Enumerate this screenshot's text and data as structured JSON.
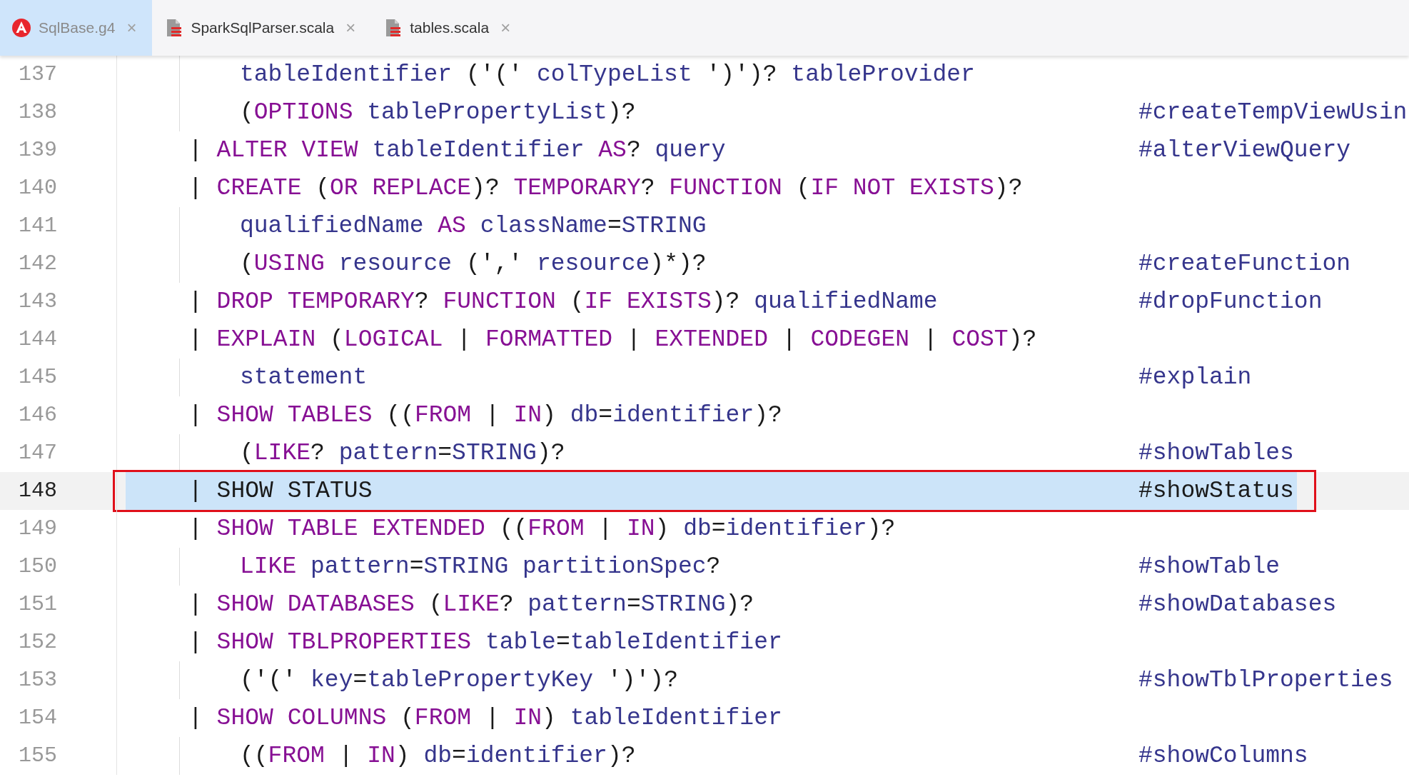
{
  "tabs": [
    {
      "label": "SqlBase.g4",
      "kind": "antlr",
      "close": "×",
      "selected": true
    },
    {
      "label": "SparkSqlParser.scala",
      "kind": "scala",
      "close": "×",
      "selected": false
    },
    {
      "label": "tables.scala",
      "kind": "scala",
      "close": "×",
      "selected": false
    }
  ],
  "lines": [
    {
      "number": "137",
      "kind": "cont",
      "selected": false,
      "tokens": [
        {
          "kind": "id",
          "text": "tableIdentifier"
        },
        {
          "kind": "p",
          "text": " ('(' "
        },
        {
          "kind": "id",
          "text": "colTypeList"
        },
        {
          "kind": "p",
          "text": " ')')? "
        },
        {
          "kind": "id",
          "text": "tableProvider"
        }
      ]
    },
    {
      "number": "138",
      "kind": "cont",
      "selected": false,
      "tokens": [
        {
          "kind": "p",
          "text": "("
        },
        {
          "kind": "kw",
          "text": "OPTIONS"
        },
        {
          "kind": "id",
          "text": " tablePropertyList"
        },
        {
          "kind": "p",
          "text": ")?"
        }
      ],
      "label": "#createTempViewUsin"
    },
    {
      "number": "139",
      "kind": "alt",
      "selected": false,
      "tokens": [
        {
          "kind": "p",
          "text": "| "
        },
        {
          "kind": "kw",
          "text": "ALTER VIEW"
        },
        {
          "kind": "id",
          "text": " tableIdentifier "
        },
        {
          "kind": "kw",
          "text": "AS"
        },
        {
          "kind": "p",
          "text": "? "
        },
        {
          "kind": "id",
          "text": "query"
        }
      ],
      "label": "#alterViewQuery"
    },
    {
      "number": "140",
      "kind": "alt",
      "selected": false,
      "tokens": [
        {
          "kind": "p",
          "text": "| "
        },
        {
          "kind": "kw",
          "text": "CREATE"
        },
        {
          "kind": "p",
          "text": " ("
        },
        {
          "kind": "kw",
          "text": "OR REPLACE"
        },
        {
          "kind": "p",
          "text": ")? "
        },
        {
          "kind": "kw",
          "text": "TEMPORARY"
        },
        {
          "kind": "p",
          "text": "? "
        },
        {
          "kind": "kw",
          "text": "FUNCTION"
        },
        {
          "kind": "p",
          "text": " ("
        },
        {
          "kind": "kw",
          "text": "IF NOT EXISTS"
        },
        {
          "kind": "p",
          "text": ")?"
        }
      ]
    },
    {
      "number": "141",
      "kind": "cont",
      "selected": false,
      "tokens": [
        {
          "kind": "id",
          "text": "qualifiedName "
        },
        {
          "kind": "kw",
          "text": "AS"
        },
        {
          "kind": "id",
          "text": " className"
        },
        {
          "kind": "p",
          "text": "="
        },
        {
          "kind": "id",
          "text": "STRING"
        }
      ]
    },
    {
      "number": "142",
      "kind": "cont",
      "selected": false,
      "tokens": [
        {
          "kind": "p",
          "text": "("
        },
        {
          "kind": "kw",
          "text": "USING"
        },
        {
          "kind": "id",
          "text": " resource"
        },
        {
          "kind": "p",
          "text": " (',' "
        },
        {
          "kind": "id",
          "text": "resource"
        },
        {
          "kind": "p",
          "text": ")*)?"
        }
      ],
      "label": "#createFunction"
    },
    {
      "number": "143",
      "kind": "alt",
      "selected": false,
      "tokens": [
        {
          "kind": "p",
          "text": "| "
        },
        {
          "kind": "kw",
          "text": "DROP TEMPORARY"
        },
        {
          "kind": "p",
          "text": "? "
        },
        {
          "kind": "kw",
          "text": "FUNCTION"
        },
        {
          "kind": "p",
          "text": " ("
        },
        {
          "kind": "kw",
          "text": "IF EXISTS"
        },
        {
          "kind": "p",
          "text": ")? "
        },
        {
          "kind": "id",
          "text": "qualifiedName"
        }
      ],
      "label": "#dropFunction"
    },
    {
      "number": "144",
      "kind": "alt",
      "selected": false,
      "tokens": [
        {
          "kind": "p",
          "text": "| "
        },
        {
          "kind": "kw",
          "text": "EXPLAIN"
        },
        {
          "kind": "p",
          "text": " ("
        },
        {
          "kind": "kw",
          "text": "LOGICAL"
        },
        {
          "kind": "p",
          "text": " | "
        },
        {
          "kind": "kw",
          "text": "FORMATTED"
        },
        {
          "kind": "p",
          "text": " | "
        },
        {
          "kind": "kw",
          "text": "EXTENDED"
        },
        {
          "kind": "p",
          "text": " | "
        },
        {
          "kind": "kw",
          "text": "CODEGEN"
        },
        {
          "kind": "p",
          "text": " | "
        },
        {
          "kind": "kw",
          "text": "COST"
        },
        {
          "kind": "p",
          "text": ")?"
        }
      ]
    },
    {
      "number": "145",
      "kind": "cont",
      "selected": false,
      "tokens": [
        {
          "kind": "id",
          "text": "statement"
        }
      ],
      "label": "#explain"
    },
    {
      "number": "146",
      "kind": "alt",
      "selected": false,
      "tokens": [
        {
          "kind": "p",
          "text": "| "
        },
        {
          "kind": "kw",
          "text": "SHOW TABLES"
        },
        {
          "kind": "p",
          "text": " (("
        },
        {
          "kind": "kw",
          "text": "FROM"
        },
        {
          "kind": "p",
          "text": " | "
        },
        {
          "kind": "kw",
          "text": "IN"
        },
        {
          "kind": "p",
          "text": ") "
        },
        {
          "kind": "id",
          "text": "db"
        },
        {
          "kind": "p",
          "text": "="
        },
        {
          "kind": "id",
          "text": "identifier"
        },
        {
          "kind": "p",
          "text": ")?"
        }
      ]
    },
    {
      "number": "147",
      "kind": "cont",
      "selected": false,
      "tokens": [
        {
          "kind": "p",
          "text": "("
        },
        {
          "kind": "kw",
          "text": "LIKE"
        },
        {
          "kind": "p",
          "text": "? "
        },
        {
          "kind": "id",
          "text": "pattern"
        },
        {
          "kind": "p",
          "text": "="
        },
        {
          "kind": "id",
          "text": "STRING"
        },
        {
          "kind": "p",
          "text": ")?"
        }
      ],
      "label": "#showTables"
    },
    {
      "number": "148",
      "kind": "alt",
      "selected": true,
      "tokens": [
        {
          "kind": "p",
          "text": "| "
        },
        {
          "kind": "kw",
          "text": "SHOW STATUS"
        }
      ],
      "label": "#showStatus"
    },
    {
      "number": "149",
      "kind": "alt",
      "selected": false,
      "tokens": [
        {
          "kind": "p",
          "text": "| "
        },
        {
          "kind": "kw",
          "text": "SHOW TABLE EXTENDED"
        },
        {
          "kind": "p",
          "text": " (("
        },
        {
          "kind": "kw",
          "text": "FROM"
        },
        {
          "kind": "p",
          "text": " | "
        },
        {
          "kind": "kw",
          "text": "IN"
        },
        {
          "kind": "p",
          "text": ") "
        },
        {
          "kind": "id",
          "text": "db"
        },
        {
          "kind": "p",
          "text": "="
        },
        {
          "kind": "id",
          "text": "identifier"
        },
        {
          "kind": "p",
          "text": ")?"
        }
      ]
    },
    {
      "number": "150",
      "kind": "cont",
      "selected": false,
      "tokens": [
        {
          "kind": "kw",
          "text": "LIKE"
        },
        {
          "kind": "id",
          "text": " pattern"
        },
        {
          "kind": "p",
          "text": "="
        },
        {
          "kind": "id",
          "text": "STRING partitionSpec"
        },
        {
          "kind": "p",
          "text": "?"
        }
      ],
      "label": "#showTable"
    },
    {
      "number": "151",
      "kind": "alt",
      "selected": false,
      "tokens": [
        {
          "kind": "p",
          "text": "| "
        },
        {
          "kind": "kw",
          "text": "SHOW DATABASES"
        },
        {
          "kind": "p",
          "text": " ("
        },
        {
          "kind": "kw",
          "text": "LIKE"
        },
        {
          "kind": "p",
          "text": "? "
        },
        {
          "kind": "id",
          "text": "pattern"
        },
        {
          "kind": "p",
          "text": "="
        },
        {
          "kind": "id",
          "text": "STRING"
        },
        {
          "kind": "p",
          "text": ")?"
        }
      ],
      "label": "#showDatabases"
    },
    {
      "number": "152",
      "kind": "alt",
      "selected": false,
      "tokens": [
        {
          "kind": "p",
          "text": "| "
        },
        {
          "kind": "kw",
          "text": "SHOW TBLPROPERTIES"
        },
        {
          "kind": "id",
          "text": " table"
        },
        {
          "kind": "p",
          "text": "="
        },
        {
          "kind": "id",
          "text": "tableIdentifier"
        }
      ]
    },
    {
      "number": "153",
      "kind": "cont",
      "selected": false,
      "tokens": [
        {
          "kind": "p",
          "text": "('(' "
        },
        {
          "kind": "id",
          "text": "key"
        },
        {
          "kind": "p",
          "text": "="
        },
        {
          "kind": "id",
          "text": "tablePropertyKey"
        },
        {
          "kind": "p",
          "text": " ')')?"
        }
      ],
      "label": "#showTblProperties"
    },
    {
      "number": "154",
      "kind": "alt",
      "selected": false,
      "tokens": [
        {
          "kind": "p",
          "text": "| "
        },
        {
          "kind": "kw",
          "text": "SHOW COLUMNS"
        },
        {
          "kind": "p",
          "text": " ("
        },
        {
          "kind": "kw",
          "text": "FROM"
        },
        {
          "kind": "p",
          "text": " | "
        },
        {
          "kind": "kw",
          "text": "IN"
        },
        {
          "kind": "p",
          "text": ") "
        },
        {
          "kind": "id",
          "text": "tableIdentifier"
        }
      ]
    },
    {
      "number": "155",
      "kind": "cont",
      "selected": false,
      "tokens": [
        {
          "kind": "p",
          "text": "(("
        },
        {
          "kind": "kw",
          "text": "FROM"
        },
        {
          "kind": "p",
          "text": " | "
        },
        {
          "kind": "kw",
          "text": "IN"
        },
        {
          "kind": "p",
          "text": ") "
        },
        {
          "kind": "id",
          "text": "db"
        },
        {
          "kind": "p",
          "text": "="
        },
        {
          "kind": "id",
          "text": "identifier"
        },
        {
          "kind": "p",
          "text": ")?"
        }
      ],
      "label": "#showColumns"
    }
  ]
}
